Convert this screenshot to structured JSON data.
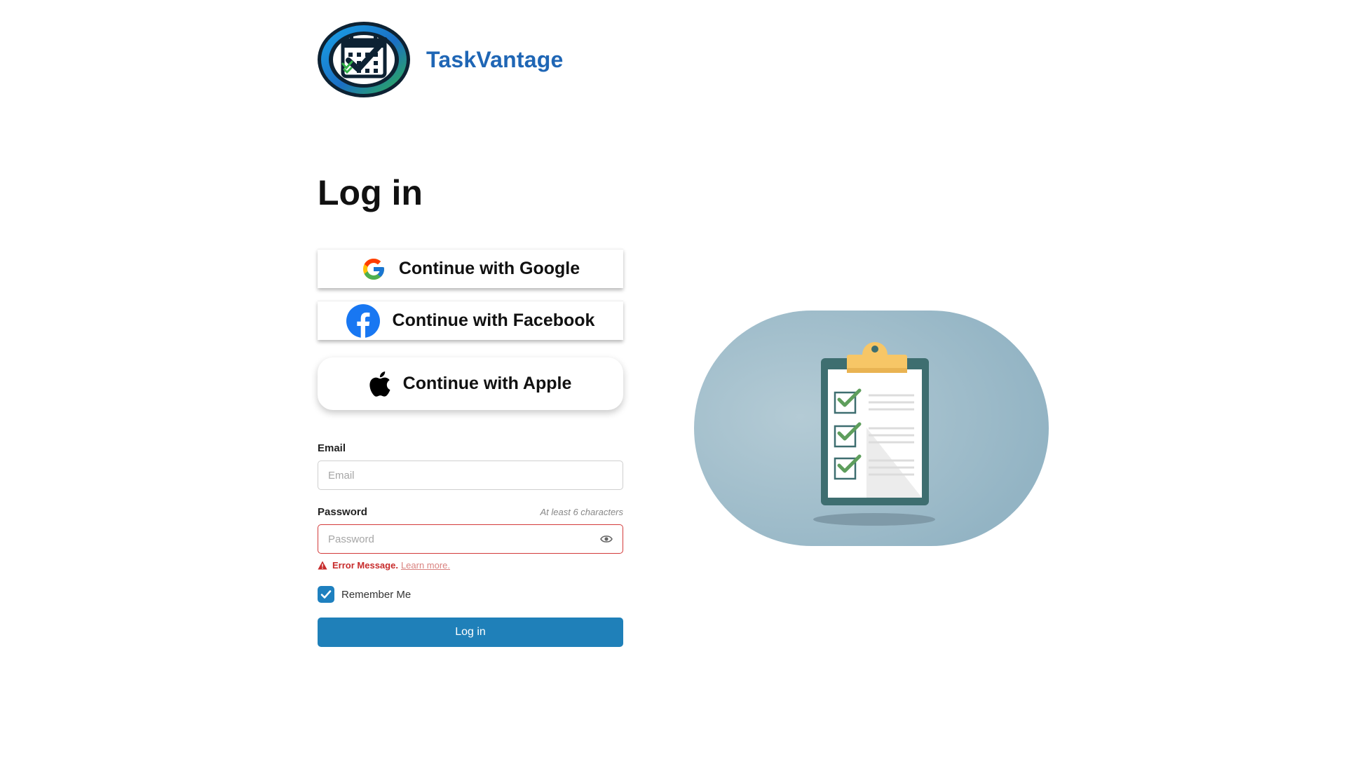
{
  "brand": {
    "name": "TaskVantage"
  },
  "page": {
    "title": "Log in"
  },
  "social": {
    "google_label": "Continue with Google",
    "facebook_label": "Continue with Facebook",
    "apple_label": "Continue with Apple"
  },
  "form": {
    "email": {
      "label": "Email",
      "placeholder": "Email",
      "value": ""
    },
    "password": {
      "label": "Password",
      "placeholder": "Password",
      "hint": "At least 6 characters",
      "value": ""
    },
    "error": {
      "message": "Error Message.",
      "link": "Learn more."
    },
    "remember": {
      "label": "Remember Me",
      "checked": true
    },
    "submit_label": "Log in"
  },
  "icons": {
    "logo": "taskvantage-logo",
    "google": "google-icon",
    "facebook": "facebook-icon",
    "apple": "apple-icon",
    "eye": "eye-icon",
    "warning": "warning-icon",
    "check": "check-icon",
    "illustration": "clipboard-checklist-illustration"
  },
  "colors": {
    "brand": "#1f66b5",
    "primary": "#1f80b9",
    "error": "#c72b2b",
    "illustration_bg": "#93b4c4"
  }
}
